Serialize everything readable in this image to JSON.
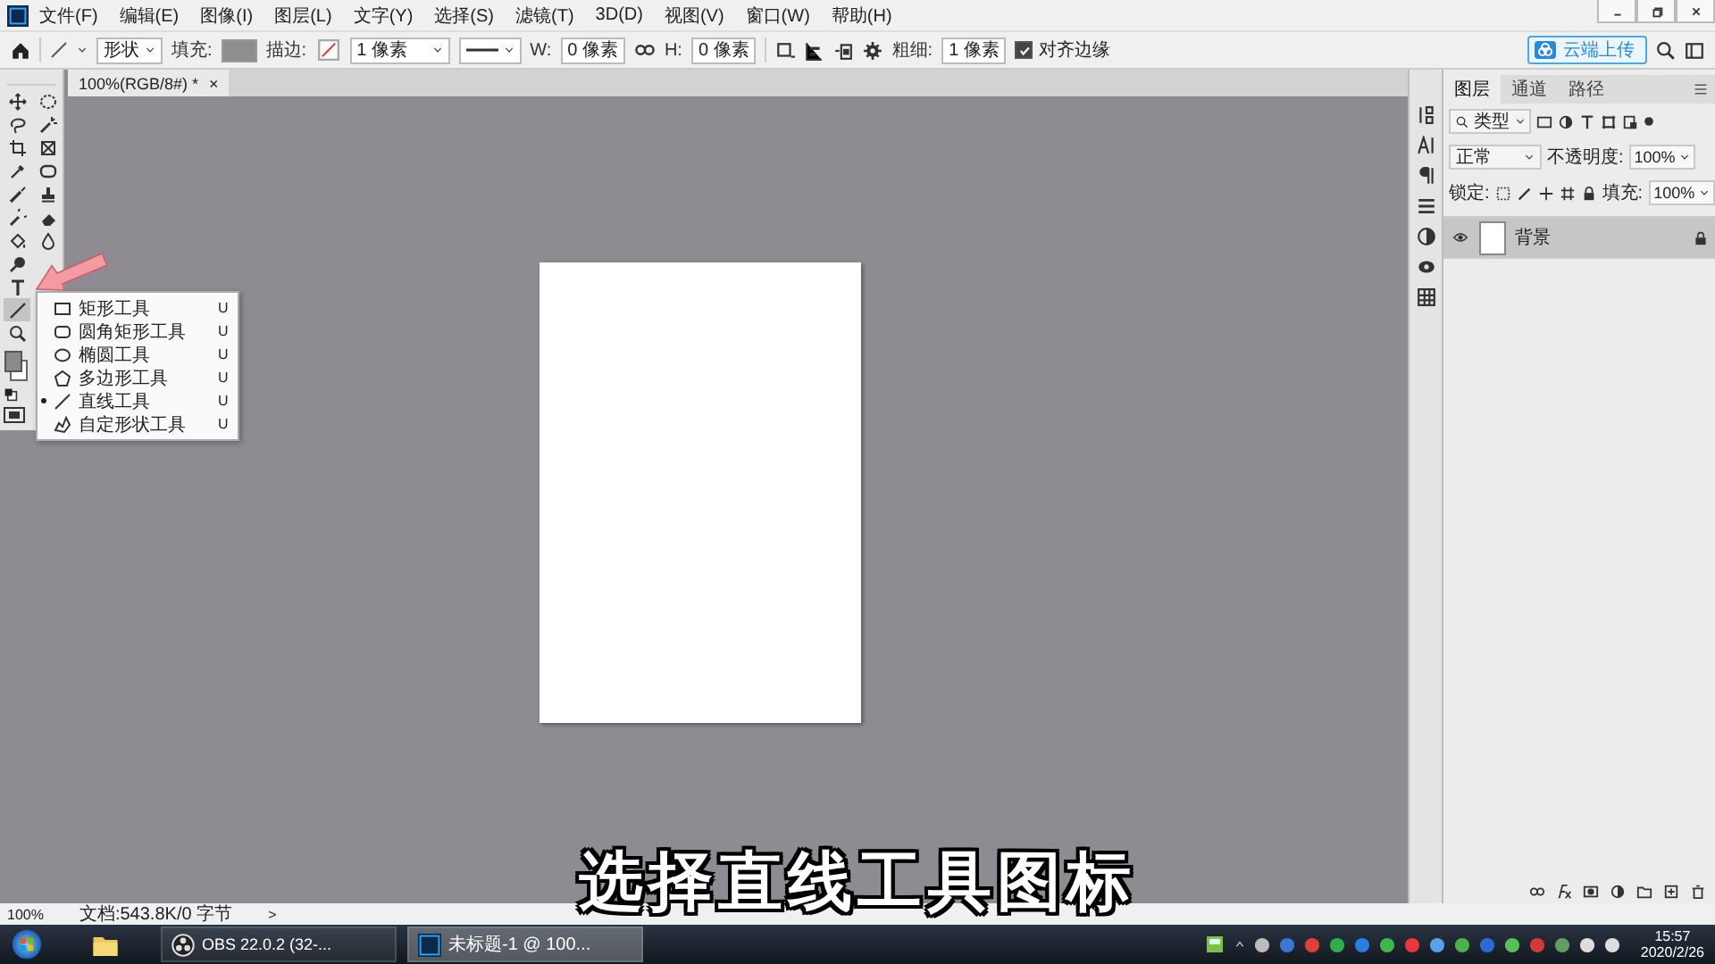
{
  "menu_bar": {
    "items": [
      "文件(F)",
      "编辑(E)",
      "图像(I)",
      "图层(L)",
      "文字(Y)",
      "选择(S)",
      "滤镜(T)",
      "3D(D)",
      "视图(V)",
      "窗口(W)",
      "帮助(H)"
    ]
  },
  "options_bar": {
    "mode": "形状",
    "fill_label": "填充:",
    "stroke_label": "描边:",
    "stroke_width": "1 像素",
    "w_label": "W:",
    "w_value": "0 像素",
    "h_label": "H:",
    "h_value": "0 像素",
    "weight_label": "粗细:",
    "weight_value": "1 像素",
    "align_edges": {
      "label": "对齐边缘",
      "checked": true
    },
    "upload_button": "云端上传"
  },
  "document_tab": {
    "title": "100%(RGB/8#) *",
    "close": "×"
  },
  "tool_rows": [
    [
      {
        "kind": "move",
        "selected": false
      },
      {
        "kind": "marquee",
        "selected": false
      }
    ],
    [
      {
        "kind": "lasso",
        "selected": false
      },
      {
        "kind": "wand",
        "selected": false
      }
    ],
    [
      {
        "kind": "crop",
        "selected": false
      },
      {
        "kind": "frame",
        "selected": false
      }
    ],
    [
      {
        "kind": "eyedropper",
        "selected": false
      },
      {
        "kind": "patch",
        "selected": false
      }
    ],
    [
      {
        "kind": "brush",
        "selected": false
      },
      {
        "kind": "stamp",
        "selected": false
      }
    ],
    [
      {
        "kind": "history",
        "selected": false
      },
      {
        "kind": "eraser",
        "selected": false
      }
    ],
    [
      {
        "kind": "bucket",
        "selected": false
      },
      {
        "kind": "blur",
        "selected": false
      }
    ],
    [
      {
        "kind": "dodge",
        "selected": false
      }
    ],
    [
      {
        "kind": "type",
        "selected": false
      }
    ],
    [
      {
        "kind": "shape",
        "selected": true
      }
    ],
    [
      {
        "kind": "zoom",
        "selected": false
      }
    ]
  ],
  "tool_flyout": {
    "items": [
      {
        "kind": "rect",
        "label": "矩形工具",
        "shortcut": "U",
        "selected": false
      },
      {
        "kind": "rounded",
        "label": "圆角矩形工具",
        "shortcut": "U",
        "selected": false
      },
      {
        "kind": "ellipse",
        "label": "椭圆工具",
        "shortcut": "U",
        "selected": false
      },
      {
        "kind": "polygon",
        "label": "多边形工具",
        "shortcut": "U",
        "selected": false
      },
      {
        "kind": "line",
        "label": "直线工具",
        "shortcut": "U",
        "selected": true
      },
      {
        "kind": "custom",
        "label": "自定形状工具",
        "shortcut": "U",
        "selected": false
      }
    ]
  },
  "layers_panel": {
    "tabs": [
      {
        "label": "图层",
        "selected": true
      },
      {
        "label": "通道",
        "selected": false
      },
      {
        "label": "路径",
        "selected": false
      }
    ],
    "filter": "类型",
    "blend_mode": "正常",
    "opacity_label": "不透明度:",
    "opacity": "100%",
    "lock_label": "锁定:",
    "fill_label": "填充:",
    "fill": "100%",
    "layers": [
      {
        "name": "背景",
        "visible": true,
        "locked": true,
        "selected": true
      }
    ]
  },
  "status_bar": {
    "zoom": "100%",
    "doc_info": "文档:543.8K/0 字节",
    "arrow": ">"
  },
  "caption": "选择直线工具图标",
  "taskbar": {
    "apps": [
      {
        "kind": "obs",
        "label": "OBS 22.0.2 (32-...",
        "selected": false
      },
      {
        "kind": "photoshop",
        "label": "未标题-1 @ 100...",
        "selected": true
      }
    ],
    "time": "15:57",
    "date": "2020/2/26"
  }
}
